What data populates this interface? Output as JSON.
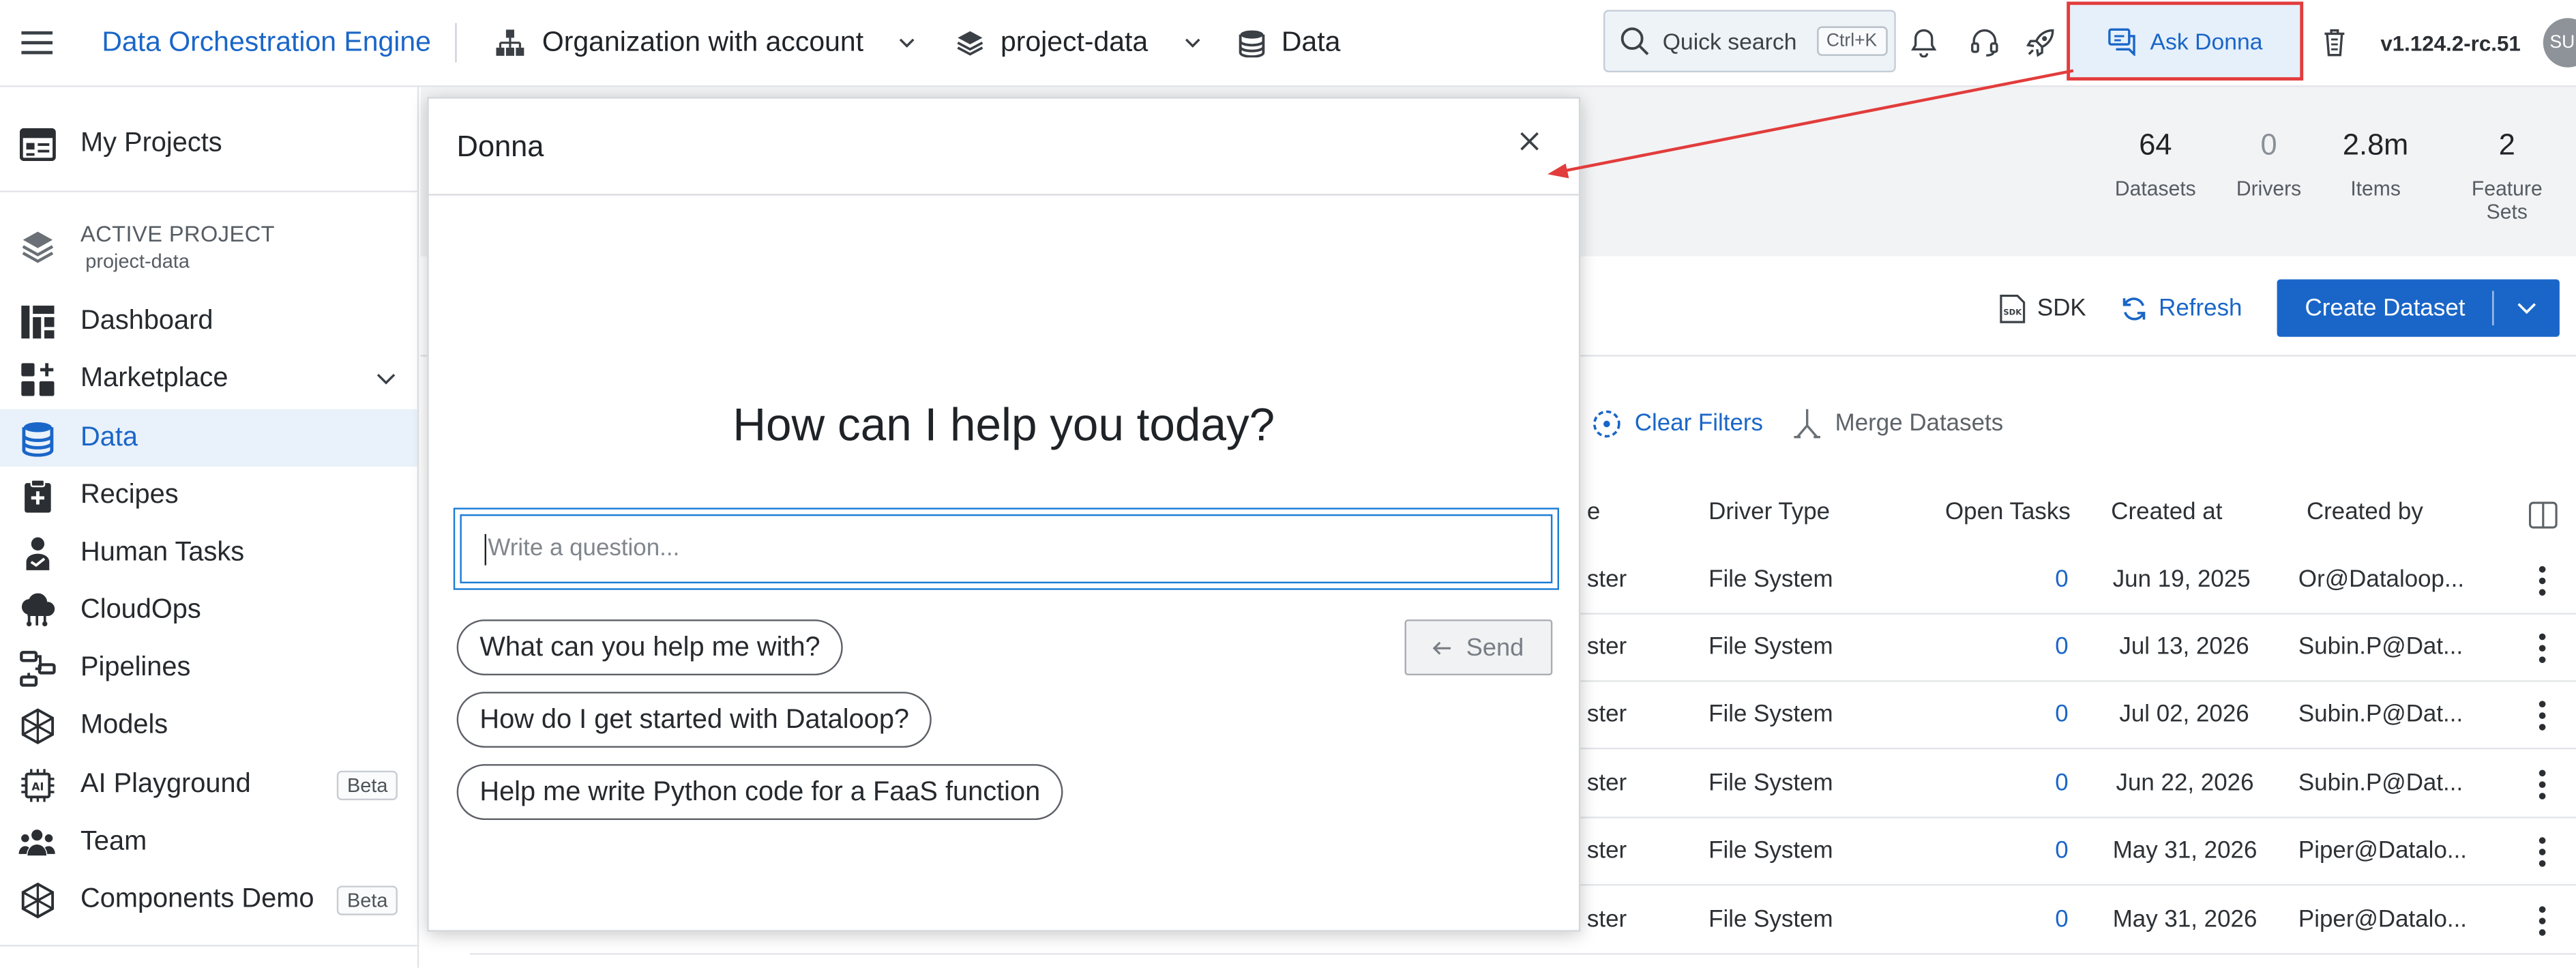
{
  "header": {
    "app_title": "Data Orchestration Engine",
    "org_name": "Organization with account",
    "project_name": "project-data",
    "section": "Data",
    "search_label": "Quick search",
    "search_shortcut": "Ctrl+K",
    "ask_donna_label": "Ask Donna",
    "version": "v1.124.2-rc.51",
    "avatar_initials": "SU"
  },
  "sidebar": {
    "my_projects": "My Projects",
    "active_project_label": "ACTIVE PROJECT",
    "active_project_name": "project-data",
    "items": [
      {
        "label": "Dashboard",
        "icon": "dashboard-icon"
      },
      {
        "label": "Marketplace",
        "icon": "marketplace-icon"
      },
      {
        "label": "Data",
        "icon": "database-icon"
      },
      {
        "label": "Recipes",
        "icon": "recipes-icon"
      },
      {
        "label": "Human Tasks",
        "icon": "human-tasks-icon"
      },
      {
        "label": "CloudOps",
        "icon": "cloud-icon"
      },
      {
        "label": "Pipelines",
        "icon": "pipelines-icon"
      },
      {
        "label": "Models",
        "icon": "models-icon"
      },
      {
        "label": "AI Playground",
        "icon": "ai-icon",
        "badge": "Beta"
      },
      {
        "label": "Team",
        "icon": "team-icon"
      },
      {
        "label": "Components Demo",
        "icon": "components-icon",
        "badge": "Beta"
      }
    ],
    "active_item": "Data"
  },
  "stats": [
    {
      "value": "64",
      "label": "Datasets"
    },
    {
      "value": "0",
      "label": "Drivers"
    },
    {
      "value": "2.8m",
      "label": "Items"
    },
    {
      "value": "2",
      "label": "Feature Sets"
    }
  ],
  "actions": {
    "sdk": "SDK",
    "refresh": "Refresh",
    "create_dataset": "Create Dataset",
    "clear_filters": "Clear Filters",
    "merge_datasets": "Merge Datasets"
  },
  "table": {
    "headers": [
      "e",
      "Driver Type",
      "Open Tasks",
      "Created at",
      "Created by"
    ],
    "rows": [
      {
        "name": "ster",
        "driver": "File System",
        "tasks": "0",
        "created": "Jun 19, 2025",
        "by": "Or@Dataloop..."
      },
      {
        "name": "ster",
        "driver": "File System",
        "tasks": "0",
        "created": "Jul 13, 2026",
        "by": "Subin.P@Dat..."
      },
      {
        "name": "ster",
        "driver": "File System",
        "tasks": "0",
        "created": "Jul 02, 2026",
        "by": "Subin.P@Dat..."
      },
      {
        "name": "ster",
        "driver": "File System",
        "tasks": "0",
        "created": "Jun 22, 2026",
        "by": "Subin.P@Dat..."
      },
      {
        "name": "ster",
        "driver": "File System",
        "tasks": "0",
        "created": "May 31, 2026",
        "by": "Piper@Datalo..."
      },
      {
        "name": "ster",
        "driver": "File System",
        "tasks": "0",
        "created": "May 31, 2026",
        "by": "Piper@Datalo..."
      }
    ]
  },
  "donna": {
    "title": "Donna",
    "heading": "How can I help you today?",
    "input_placeholder": "Write a question...",
    "send_label": "Send",
    "suggestions": [
      "What can you help me with?",
      "How do I get started with Dataloop?",
      "Help me write Python code for a FaaS function"
    ]
  },
  "colors": {
    "accent": "#1a66c8",
    "annotation": "#e23c3c",
    "active_bg": "#e9f1fa"
  }
}
